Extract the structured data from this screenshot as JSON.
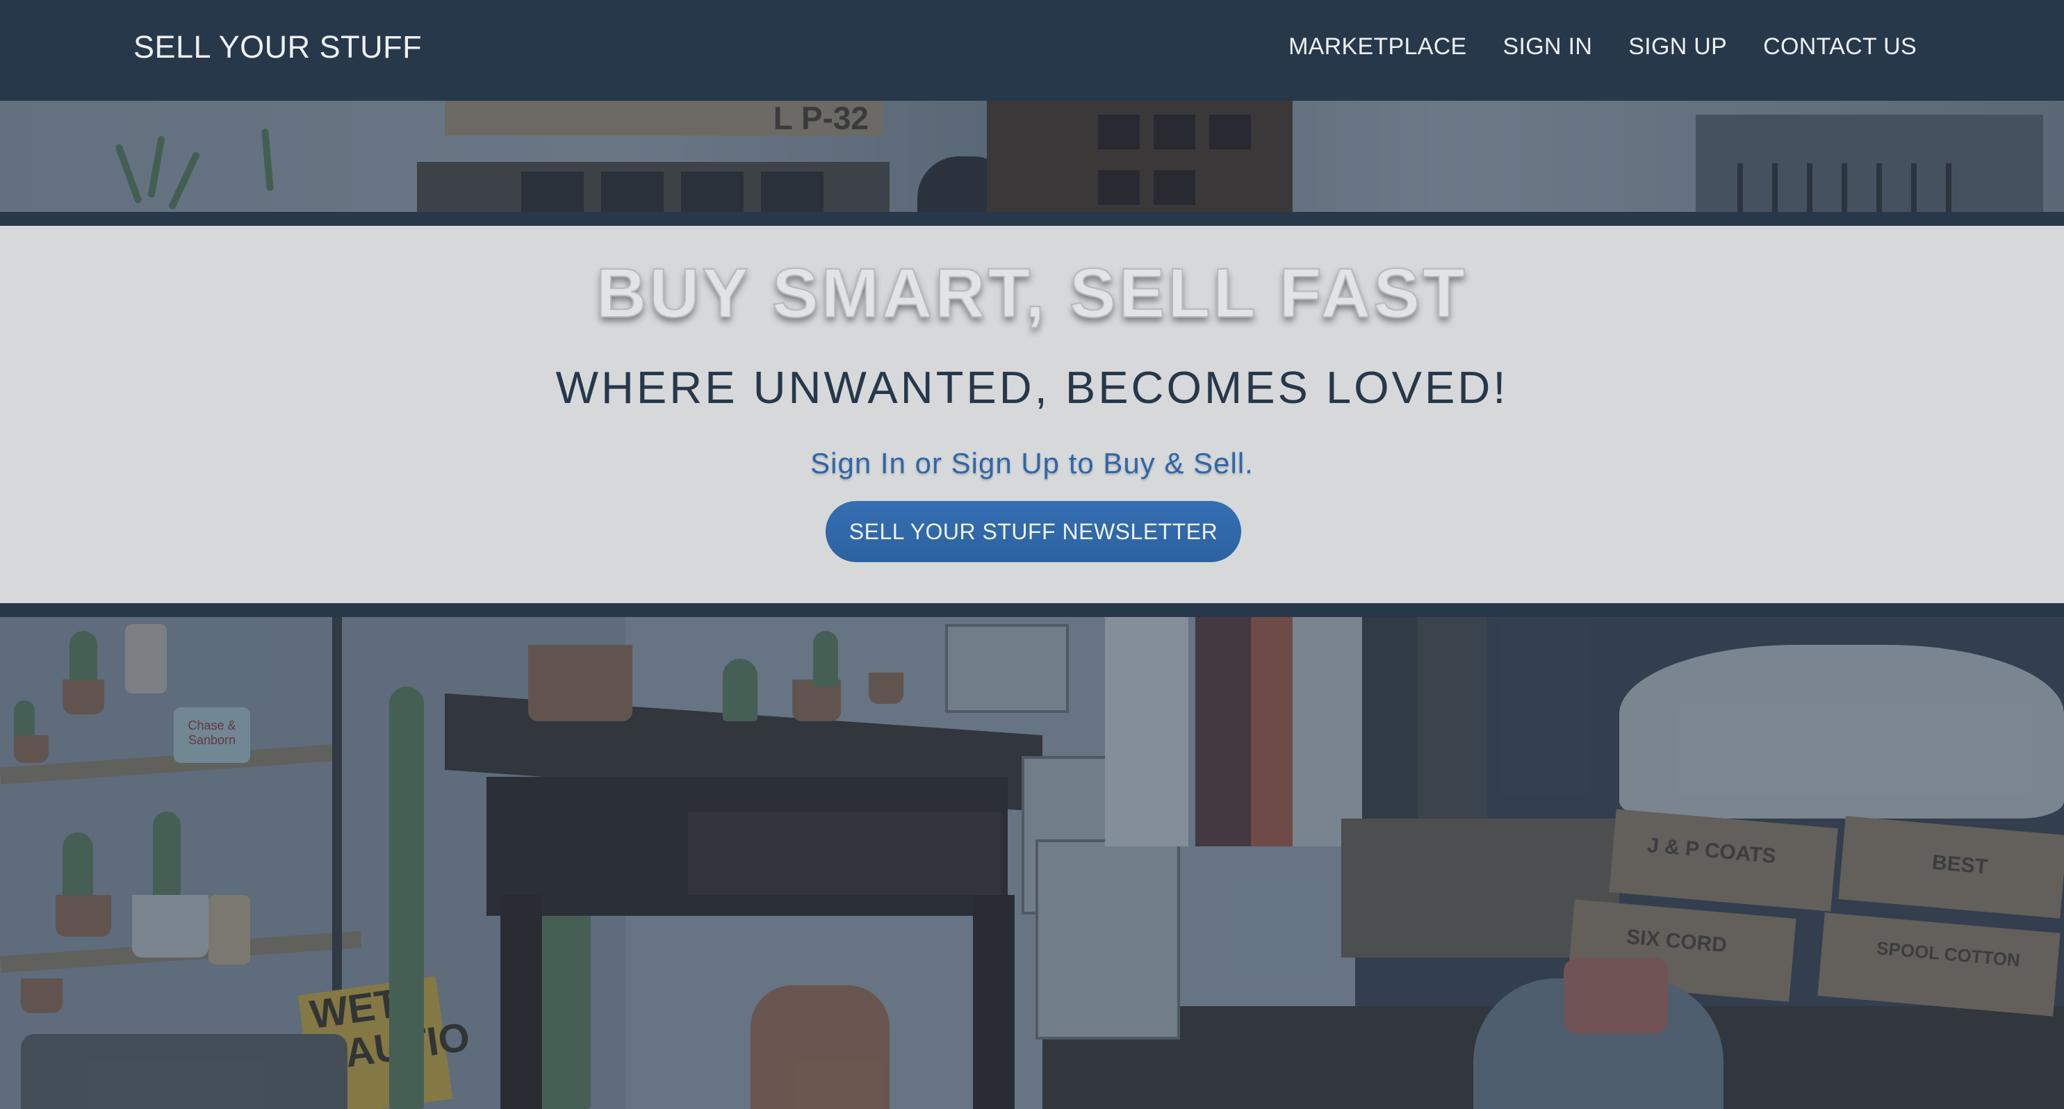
{
  "navbar": {
    "brand": "SELL YOUR STUFF",
    "links": [
      "MARKETPLACE",
      "SIGN IN",
      "SIGN UP",
      "CONTACT US"
    ]
  },
  "hero": {
    "title": "BUY SMART, SELL FAST",
    "subtitle": "WHERE UNWANTED, BECOMES LOVED!",
    "cta_text": "Sign In or Sign Up to Buy & Sell.",
    "button_label": "SELL YOUR STUFF NEWSLETTER"
  },
  "photo_top": {
    "sign_text": "L P-32"
  },
  "photo_bottom": {
    "tin_label": "Chase & Sanborn",
    "crate_labels": [
      "J & P COATS",
      "SIX CORD",
      "BEST",
      "SPOOL COTTON"
    ],
    "caution_text": "WET CAUTIO"
  },
  "colors": {
    "navbar_bg": "#26384a",
    "hero_bg": "#d6d8da",
    "subtitle": "#26384a",
    "accent_blue": "#2f66a8",
    "button_bg": "#2d629f"
  }
}
